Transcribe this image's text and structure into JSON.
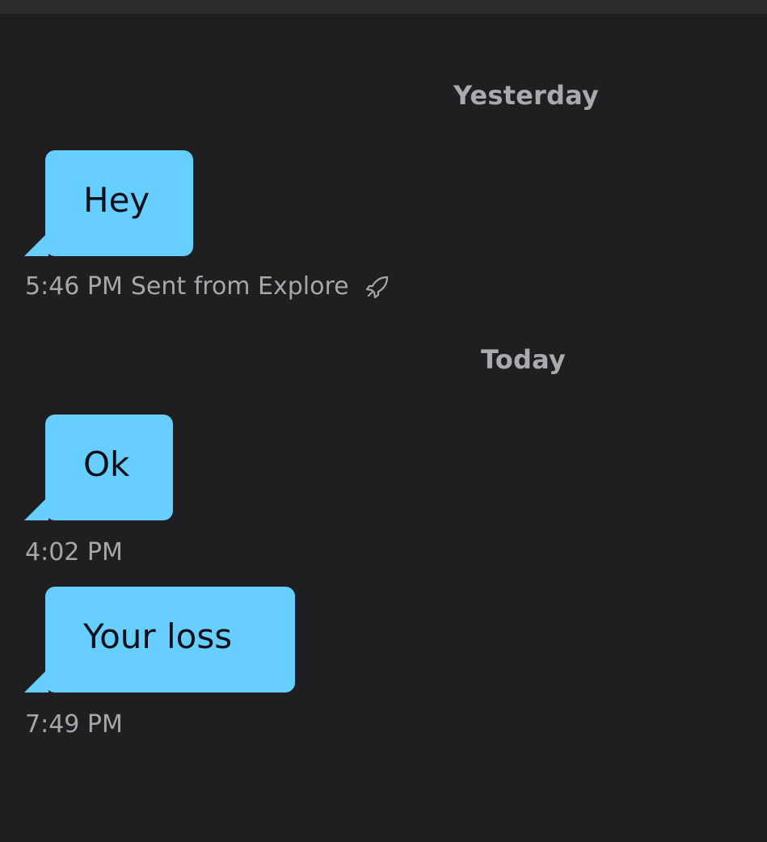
{
  "thread": {
    "days": [
      {
        "label": "Yesterday",
        "messages": [
          {
            "text": "Hey",
            "time": "5:46 PM",
            "note": "Sent from Explore",
            "icon": "rocket-icon"
          }
        ]
      },
      {
        "label": "Today",
        "messages": [
          {
            "text": "Ok",
            "time": "4:02 PM"
          },
          {
            "text": "Your loss",
            "time": "7:49 PM"
          }
        ]
      }
    ]
  },
  "colors": {
    "background": "#1f1f21",
    "bubble": "#66cfff",
    "bubble_text": "#0b0f1a",
    "meta_text": "#a6a6ab",
    "divider_text": "#a9a9ae"
  }
}
